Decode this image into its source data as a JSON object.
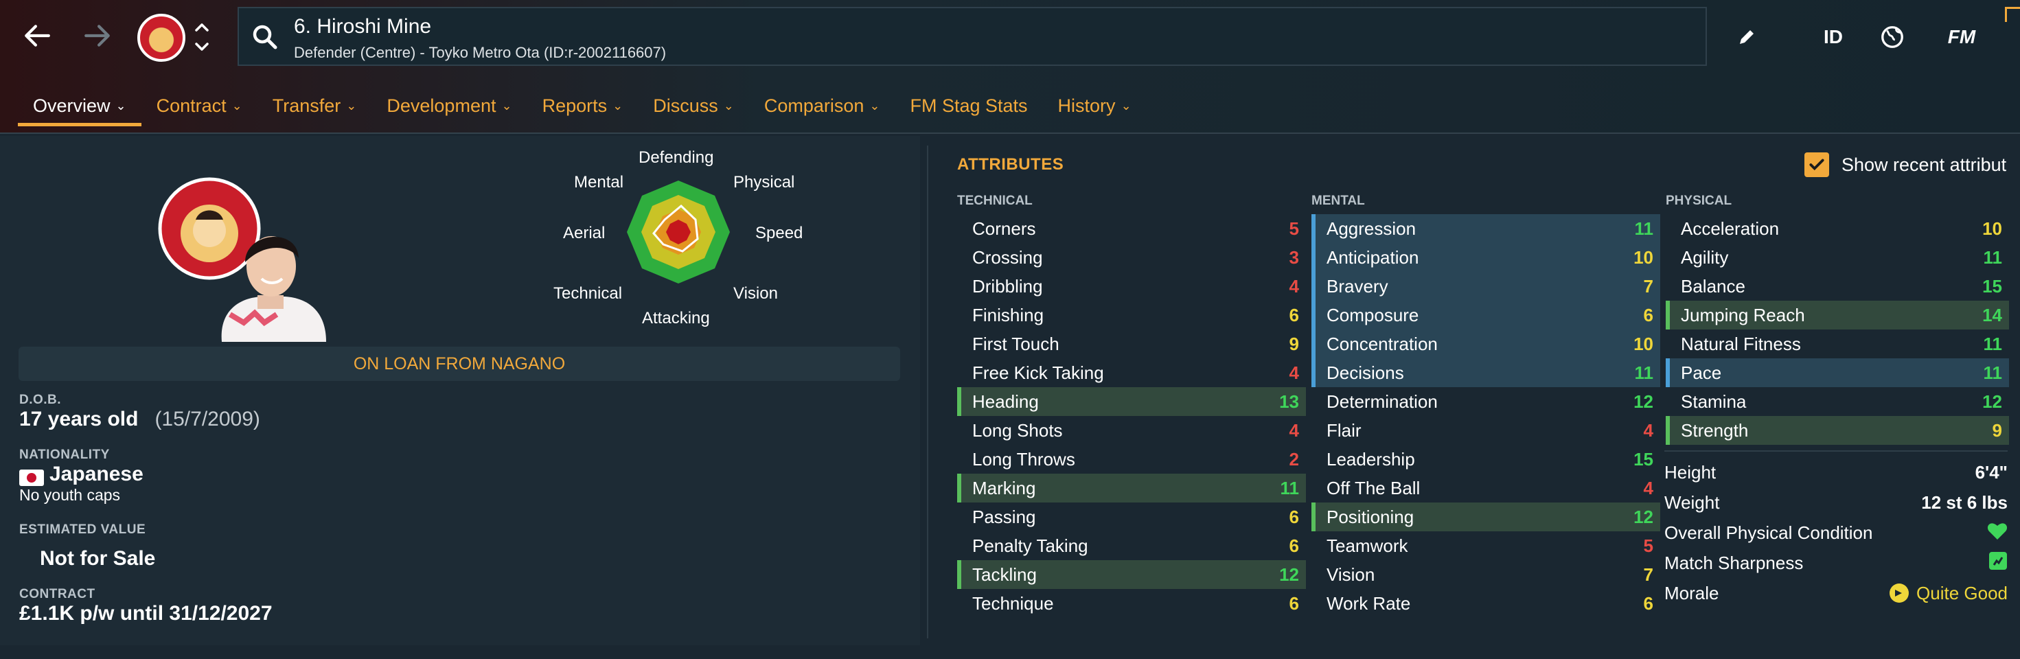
{
  "header": {
    "player_name": "6. Hiroshi Mine",
    "player_subtitle": "Defender (Centre) - Toyko Metro Ota (ID:r-2002116607)",
    "icons": [
      "back-arrow-icon",
      "forward-arrow-icon",
      "club-badge",
      "up-down-chevron-icon",
      "search-icon",
      "pencil-icon",
      "id-icon",
      "globe-icon",
      "fm-icon"
    ],
    "id_label": "ID",
    "fm_label": "FM"
  },
  "tabs": [
    {
      "label": "Overview",
      "dropdown": true
    },
    {
      "label": "Contract",
      "dropdown": true
    },
    {
      "label": "Transfer",
      "dropdown": true
    },
    {
      "label": "Development",
      "dropdown": true
    },
    {
      "label": "Reports",
      "dropdown": true
    },
    {
      "label": "Discuss",
      "dropdown": true
    },
    {
      "label": "Comparison",
      "dropdown": true
    },
    {
      "label": "FM Stag Stats",
      "dropdown": false
    },
    {
      "label": "History",
      "dropdown": true
    }
  ],
  "profile": {
    "loan_banner": "ON LOAN FROM NAGANO",
    "dob_label": "D.O.B.",
    "age": "17 years old",
    "dob": "(15/7/2009)",
    "nationality_label": "NATIONALITY",
    "nationality": "Japanese",
    "caps": "No youth caps",
    "value_label": "ESTIMATED VALUE",
    "value": "Not for Sale",
    "contract_label": "CONTRACT",
    "contract": "£1.1K p/w until 31/12/2027"
  },
  "radar": {
    "labels": {
      "top": "Defending",
      "top_right": "Physical",
      "right": "Speed",
      "bottom_right": "Vision",
      "bottom": "Attacking",
      "bottom_left": "Technical",
      "left": "Aerial",
      "top_left": "Mental"
    },
    "colors": {
      "green": "#2fae3e",
      "yellow": "#c9c326",
      "orange": "#e39420",
      "red": "#c4161c"
    }
  },
  "attributes": {
    "title": "ATTRIBUTES",
    "show_recent_label": "Show recent attribut",
    "technical_label": "TECHNICAL",
    "mental_label": "MENTAL",
    "physical_label": "PHYSICAL",
    "technical": [
      {
        "name": "Corners",
        "value": "5",
        "color": "red",
        "hl": ""
      },
      {
        "name": "Crossing",
        "value": "3",
        "color": "red",
        "hl": ""
      },
      {
        "name": "Dribbling",
        "value": "4",
        "color": "red",
        "hl": ""
      },
      {
        "name": "Finishing",
        "value": "6",
        "color": "yellow",
        "hl": ""
      },
      {
        "name": "First Touch",
        "value": "9",
        "color": "yellow",
        "hl": ""
      },
      {
        "name": "Free Kick Taking",
        "value": "4",
        "color": "red",
        "hl": ""
      },
      {
        "name": "Heading",
        "value": "13",
        "color": "green",
        "hl": "g"
      },
      {
        "name": "Long Shots",
        "value": "4",
        "color": "red",
        "hl": ""
      },
      {
        "name": "Long Throws",
        "value": "2",
        "color": "red",
        "hl": ""
      },
      {
        "name": "Marking",
        "value": "11",
        "color": "green",
        "hl": "g"
      },
      {
        "name": "Passing",
        "value": "6",
        "color": "yellow",
        "hl": ""
      },
      {
        "name": "Penalty Taking",
        "value": "6",
        "color": "yellow",
        "hl": ""
      },
      {
        "name": "Tackling",
        "value": "12",
        "color": "green",
        "hl": "g"
      },
      {
        "name": "Technique",
        "value": "6",
        "color": "yellow",
        "hl": ""
      }
    ],
    "mental": [
      {
        "name": "Aggression",
        "value": "11",
        "color": "green",
        "hl": "b"
      },
      {
        "name": "Anticipation",
        "value": "10",
        "color": "yellow",
        "hl": "b"
      },
      {
        "name": "Bravery",
        "value": "7",
        "color": "yellow",
        "hl": "b"
      },
      {
        "name": "Composure",
        "value": "6",
        "color": "yellow",
        "hl": "b"
      },
      {
        "name": "Concentration",
        "value": "10",
        "color": "yellow",
        "hl": "b"
      },
      {
        "name": "Decisions",
        "value": "11",
        "color": "green",
        "hl": "b"
      },
      {
        "name": "Determination",
        "value": "12",
        "color": "green",
        "hl": ""
      },
      {
        "name": "Flair",
        "value": "4",
        "color": "red",
        "hl": ""
      },
      {
        "name": "Leadership",
        "value": "15",
        "color": "green",
        "hl": ""
      },
      {
        "name": "Off The Ball",
        "value": "4",
        "color": "red",
        "hl": ""
      },
      {
        "name": "Positioning",
        "value": "12",
        "color": "green",
        "hl": "g"
      },
      {
        "name": "Teamwork",
        "value": "5",
        "color": "red",
        "hl": ""
      },
      {
        "name": "Vision",
        "value": "7",
        "color": "yellow",
        "hl": ""
      },
      {
        "name": "Work Rate",
        "value": "6",
        "color": "yellow",
        "hl": ""
      }
    ],
    "physical": [
      {
        "name": "Acceleration",
        "value": "10",
        "color": "yellow",
        "hl": ""
      },
      {
        "name": "Agility",
        "value": "11",
        "color": "green",
        "hl": ""
      },
      {
        "name": "Balance",
        "value": "15",
        "color": "green",
        "hl": ""
      },
      {
        "name": "Jumping Reach",
        "value": "14",
        "color": "green",
        "hl": "g"
      },
      {
        "name": "Natural Fitness",
        "value": "11",
        "color": "green",
        "hl": ""
      },
      {
        "name": "Pace",
        "value": "11",
        "color": "green",
        "hl": "b"
      },
      {
        "name": "Stamina",
        "value": "12",
        "color": "green",
        "hl": ""
      },
      {
        "name": "Strength",
        "value": "9",
        "color": "yellow",
        "hl": "g"
      }
    ],
    "physical_info": [
      {
        "label": "Height",
        "value": "6'4\""
      },
      {
        "label": "Weight",
        "value": "12 st 6 lbs"
      },
      {
        "label": "Overall Physical Condition",
        "value": "",
        "icon": "heart-icon"
      },
      {
        "label": "Match Sharpness",
        "value": "",
        "icon": "sharpness-icon"
      },
      {
        "label": "Morale",
        "value": "Quite Good",
        "icon": "morale-icon"
      }
    ]
  }
}
